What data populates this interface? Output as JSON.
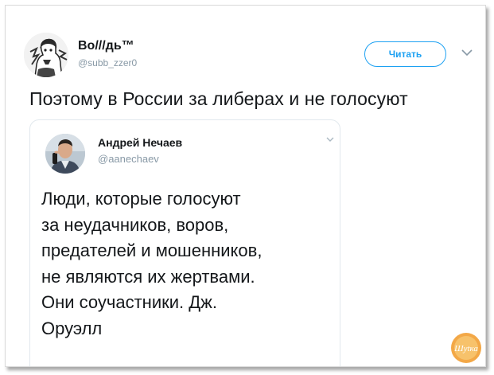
{
  "tweet": {
    "author": {
      "name": "Во///дь™",
      "handle": "@subb_zzer0",
      "avatar_icon": "ink-portrait-avatar"
    },
    "follow_label": "Читать",
    "menu_icon": "chevron-down-icon",
    "text": "Поэтому в России за либерах и не голосуют",
    "quoted": {
      "author": {
        "name": "Андрей Нечаев",
        "handle": "@aanechaev",
        "avatar_icon": "man-photo-avatar"
      },
      "menu_icon": "chevron-down-icon",
      "lines": [
        "Люди, которые голосуют",
        "за неудачников, воров,",
        "предателей и мошенников,",
        "не являются их жертвами.",
        "Они соучастники. Дж.",
        "Оруэлл"
      ]
    }
  },
  "watermark": {
    "text": "Шуtка",
    "icon": "watermark-logo"
  },
  "colors": {
    "accent": "#1da1f2",
    "text": "#14171a",
    "muted": "#8899a6",
    "border": "#e1e8ed",
    "watermark": "#f0a040"
  }
}
